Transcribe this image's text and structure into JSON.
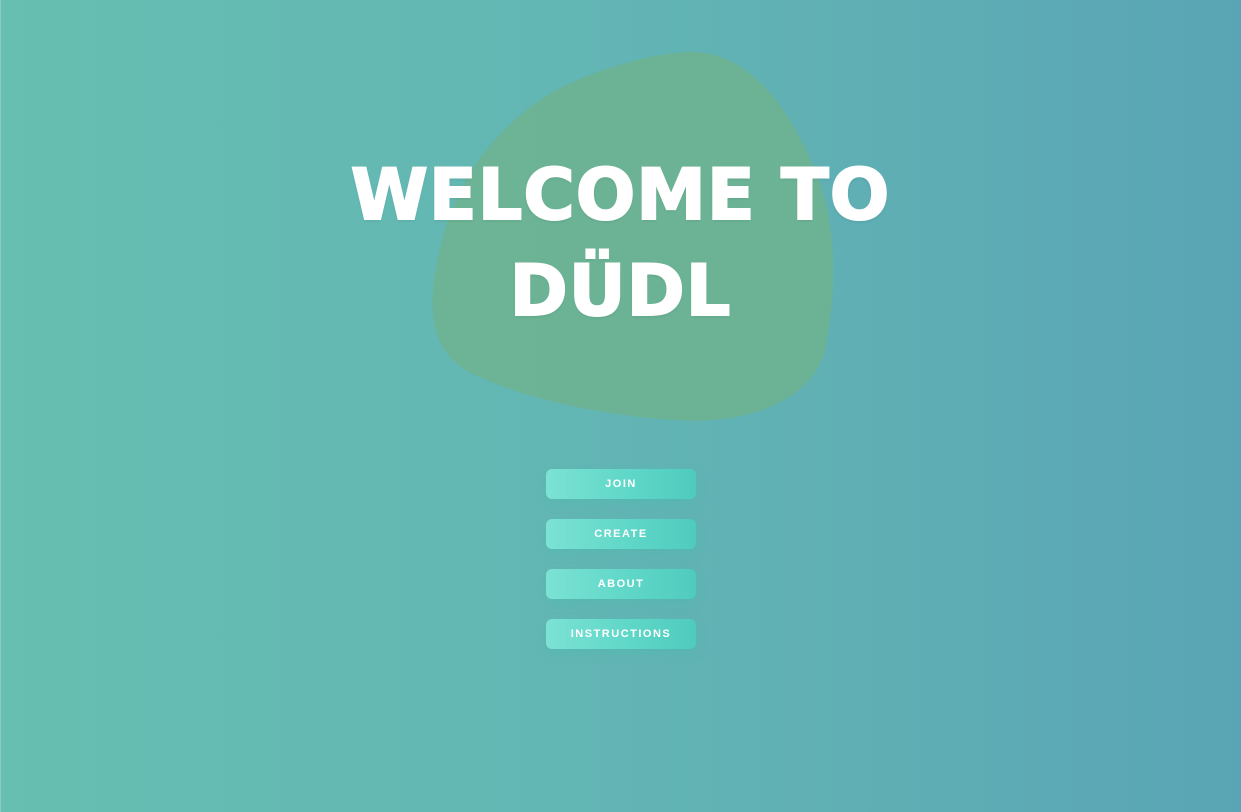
{
  "hero": {
    "title_line1": "WELCOME TO",
    "title_line2": "DÜDL"
  },
  "menu": {
    "join_label": "JOIN",
    "create_label": "CREATE",
    "about_label": "ABOUT",
    "instructions_label": "INSTRUCTIONS"
  },
  "colors": {
    "background_start": "#66bfb1",
    "background_end": "#5aa5b5",
    "blob": "#6db393",
    "button_start": "#7ce2d4",
    "button_end": "#4fcbbd",
    "text": "#ffffff"
  }
}
